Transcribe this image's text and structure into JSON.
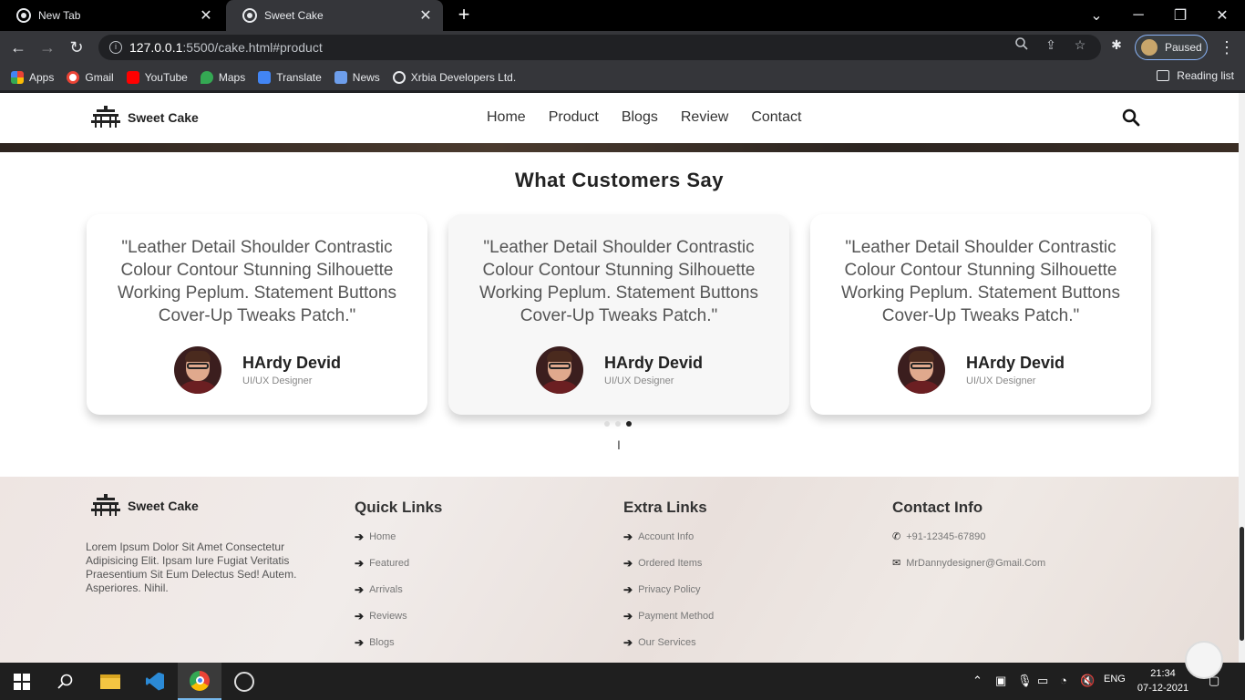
{
  "browser": {
    "tabs": [
      {
        "title": "New Tab",
        "active": false
      },
      {
        "title": "Sweet Cake",
        "active": true
      }
    ],
    "url_host": "127.0.0.1",
    "url_rest": ":5500/cake.html#product",
    "profile_label": "Paused",
    "bookmarks": [
      "Apps",
      "Gmail",
      "YouTube",
      "Maps",
      "Translate",
      "News",
      "Xrbia Developers Ltd."
    ],
    "reading_list": "Reading list"
  },
  "site": {
    "logo_text": "Sweet Cake",
    "nav": [
      "Home",
      "Product",
      "Blogs",
      "Review",
      "Contact"
    ],
    "section_title": "What Customers Say",
    "testimonials": [
      {
        "quote": "\"Leather Detail Shoulder Contrastic Colour Contour Stunning Silhouette Working Peplum. Statement Buttons Cover-Up Tweaks Patch.\"",
        "name": "HArdy Devid",
        "role": "UI/UX Designer"
      },
      {
        "quote": "\"Leather Detail Shoulder Contrastic Colour Contour Stunning Silhouette Working Peplum. Statement Buttons Cover-Up Tweaks Patch.\"",
        "name": "HArdy Devid",
        "role": "UI/UX Designer"
      },
      {
        "quote": "\"Leather Detail Shoulder Contrastic Colour Contour Stunning Silhouette Working Peplum. Statement Buttons Cover-Up Tweaks Patch.\"",
        "name": "HArdy Devid",
        "role": "UI/UX Designer"
      }
    ],
    "carousel_active_index": 2,
    "footer": {
      "about_text": "Lorem Ipsum Dolor Sit Amet Consectetur Adipisicing Elit. Ipsam Iure Fugiat Veritatis Praesentium Sit Eum Delectus Sed! Autem. Asperiores. Nihil.",
      "quick_links_title": "Quick Links",
      "quick_links": [
        "Home",
        "Featured",
        "Arrivals",
        "Reviews",
        "Blogs"
      ],
      "extra_links_title": "Extra Links",
      "extra_links": [
        "Account Info",
        "Ordered Items",
        "Privacy Policy",
        "Payment Method",
        "Our Services"
      ],
      "contact_title": "Contact Info",
      "phone": "+91-12345-67890",
      "email": "MrDannydesigner@Gmail.Com"
    }
  },
  "taskbar": {
    "language": "ENG",
    "time": "21:34",
    "date": "07-12-2021"
  },
  "colors": {
    "accent": "#222222",
    "chrome_dark": "#35363a",
    "profile_border": "#8ab4f8"
  }
}
